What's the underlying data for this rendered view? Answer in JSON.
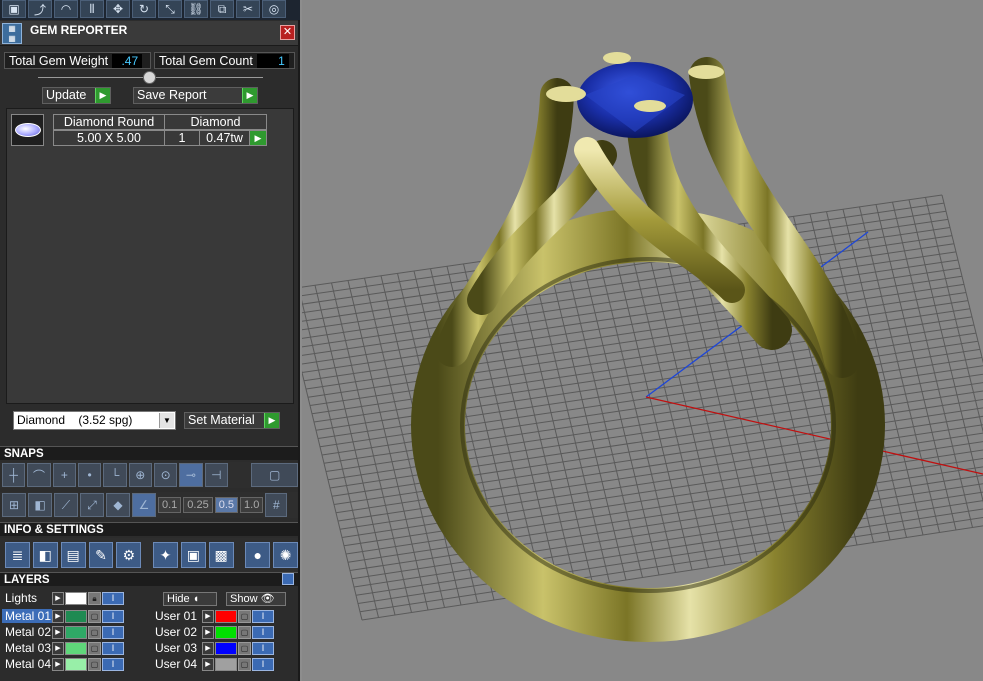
{
  "toolbar": {
    "icons": [
      "box-tool-icon",
      "curve-tool-icon",
      "arc-tool-icon",
      "mirror-tool-icon",
      "move-tool-icon",
      "rotate-tool-icon",
      "scale-tool-icon",
      "link-tool-icon",
      "copy-tool-icon",
      "cut-tool-icon",
      "globe-tool-icon"
    ]
  },
  "gem_reporter": {
    "title": "GEM REPORTER",
    "total_weight_label": "Total Gem Weight",
    "total_weight_value": ".47",
    "total_count_label": "Total Gem Count",
    "total_count_value": "1",
    "update_label": "Update",
    "save_report_label": "Save Report",
    "columns": [
      "Diamond Round",
      "Diamond"
    ],
    "row": {
      "size": "5.00 X 5.00",
      "count": "1",
      "weight": "0.47tw"
    },
    "material_select": "Diamond    (3.52 spg)",
    "set_material_label": "Set Material"
  },
  "snaps": {
    "title": "SNAPS",
    "values": [
      "0.1",
      "0.25",
      "0.5",
      "1.0"
    ],
    "active_value": "0.5"
  },
  "info_settings": {
    "title": "INFO & SETTINGS"
  },
  "layers": {
    "title": "LAYERS",
    "lights_label": "Lights",
    "hide_label": "Hide",
    "show_label": "Show",
    "metal": [
      {
        "name": "Metal 01",
        "color": "#1f8a52",
        "selected": true
      },
      {
        "name": "Metal 02",
        "color": "#2fa866"
      },
      {
        "name": "Metal 03",
        "color": "#5fd67a"
      },
      {
        "name": "Metal 04",
        "color": "#98efa8"
      }
    ],
    "user": [
      {
        "name": "User 01",
        "color": "#ff0000"
      },
      {
        "name": "User 02",
        "color": "#00e000"
      },
      {
        "name": "User 03",
        "color": "#0000ff"
      },
      {
        "name": "User 04",
        "color": "#a0a0a0"
      }
    ]
  }
}
